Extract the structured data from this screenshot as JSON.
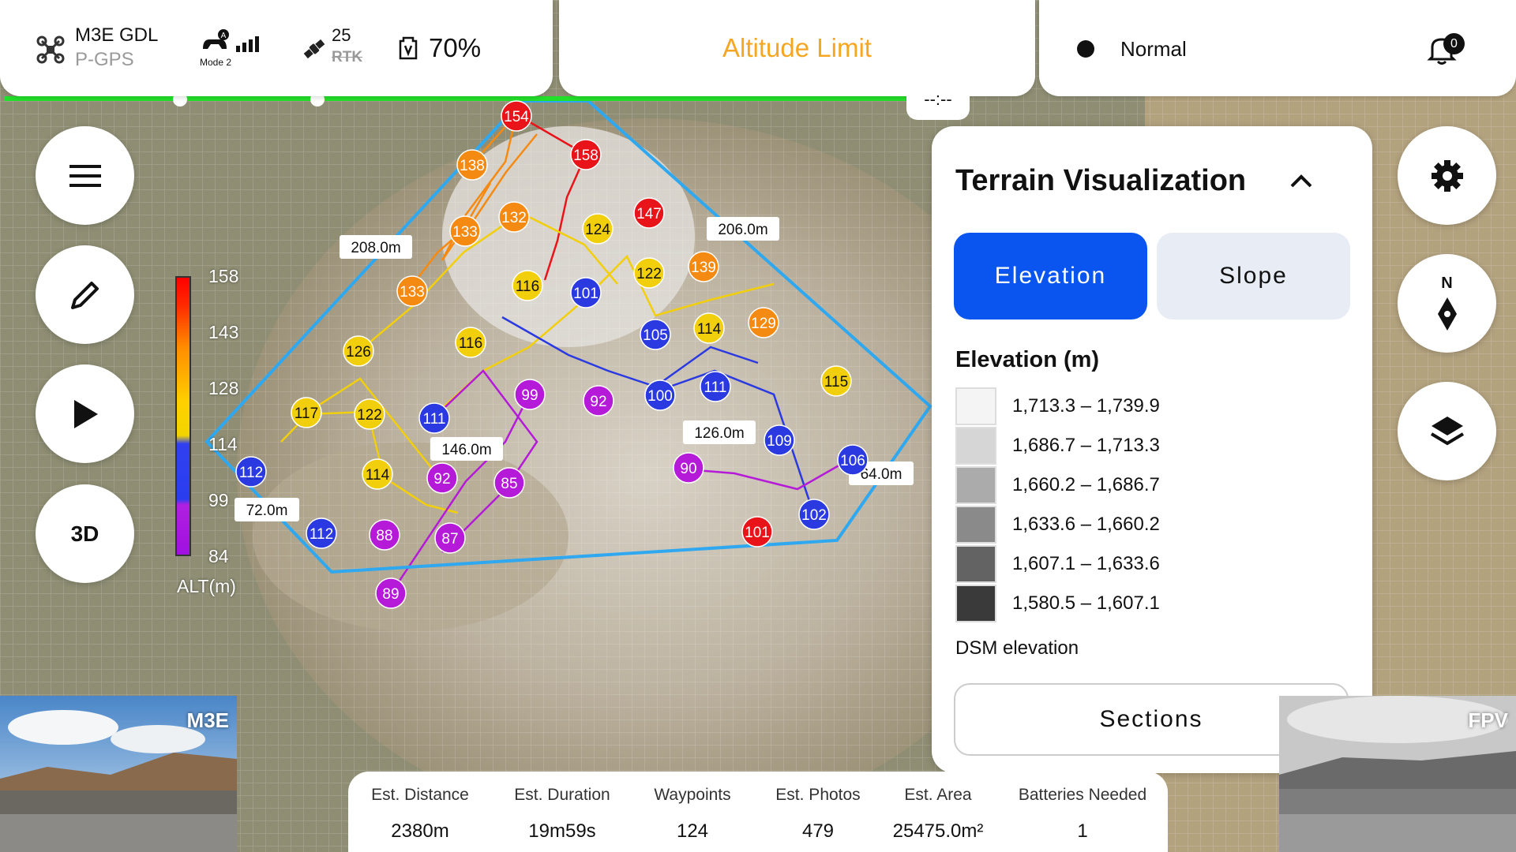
{
  "status": {
    "drone_name": "M3E GDL",
    "gps_mode": "P-GPS",
    "rc_mode": "Mode 2",
    "satellite_count": "25",
    "rtk_label": "RTK",
    "battery_percent": "70%"
  },
  "warning": {
    "text": "Altitude Limit"
  },
  "notice": {
    "status_text": "Normal",
    "notification_count": "0"
  },
  "time_remaining": "--:--",
  "left_buttons": {
    "three_d_label": "3D"
  },
  "altitude_legend": {
    "ticks": [
      "158",
      "143",
      "128",
      "114",
      "99",
      "84"
    ],
    "unit": "ALT(m)"
  },
  "compass": {
    "north_label": "N"
  },
  "terrain_panel": {
    "title": "Terrain Visualization",
    "tabs": [
      {
        "label": "Elevation",
        "active": true
      },
      {
        "label": "Slope",
        "active": false
      }
    ],
    "subtitle": "Elevation (m)",
    "legend": [
      {
        "range": "1,713.3 – 1,739.9",
        "color": "#f4f4f4"
      },
      {
        "range": "1,686.7 – 1,713.3",
        "color": "#d6d6d6"
      },
      {
        "range": "1,660.2 – 1,686.7",
        "color": "#ababab"
      },
      {
        "range": "1,633.6 – 1,660.2",
        "color": "#8a8a8a"
      },
      {
        "range": "1,607.1 – 1,633.6",
        "color": "#636363"
      },
      {
        "range": "1,580.5 – 1,607.1",
        "color": "#3a3a3a"
      }
    ],
    "note": "DSM elevation",
    "sections_label": "Sections"
  },
  "distance_labels": [
    "208.0m",
    "206.0m",
    "146.0m",
    "126.0m",
    "72.0m",
    "64.0m"
  ],
  "waypoints": [
    {
      "label": "154",
      "color": "#e8141a"
    },
    {
      "label": "158",
      "color": "#e8141a"
    },
    {
      "label": "138",
      "color": "#f58a12"
    },
    {
      "label": "147",
      "color": "#e8141a"
    },
    {
      "label": "133",
      "color": "#f58a12"
    },
    {
      "label": "132",
      "color": "#f58a12"
    },
    {
      "label": "124",
      "color": "#f2cf0c"
    },
    {
      "label": "133",
      "color": "#f58a12"
    },
    {
      "label": "116",
      "color": "#f2cf0c"
    },
    {
      "label": "101",
      "color": "#2a3ae0"
    },
    {
      "label": "122",
      "color": "#f2cf0c"
    },
    {
      "label": "139",
      "color": "#f58a12"
    },
    {
      "label": "116",
      "color": "#f2cf0c"
    },
    {
      "label": "105",
      "color": "#2a3ae0"
    },
    {
      "label": "114",
      "color": "#f2cf0c"
    },
    {
      "label": "129",
      "color": "#f58a12"
    },
    {
      "label": "126",
      "color": "#f2cf0c"
    },
    {
      "label": "99",
      "color": "#b41ad8"
    },
    {
      "label": "92",
      "color": "#b41ad8"
    },
    {
      "label": "100",
      "color": "#2a3ae0"
    },
    {
      "label": "111",
      "color": "#2a3ae0"
    },
    {
      "label": "115",
      "color": "#f2cf0c"
    },
    {
      "label": "117",
      "color": "#f2cf0c"
    },
    {
      "label": "122",
      "color": "#f2cf0c"
    },
    {
      "label": "111",
      "color": "#2a3ae0"
    },
    {
      "label": "109",
      "color": "#2a3ae0"
    },
    {
      "label": "112",
      "color": "#2a3ae0"
    },
    {
      "label": "114",
      "color": "#f2cf0c"
    },
    {
      "label": "92",
      "color": "#b41ad8"
    },
    {
      "label": "85",
      "color": "#b41ad8"
    },
    {
      "label": "90",
      "color": "#b41ad8"
    },
    {
      "label": "106",
      "color": "#2a3ae0"
    },
    {
      "label": "112",
      "color": "#2a3ae0"
    },
    {
      "label": "88",
      "color": "#b41ad8"
    },
    {
      "label": "87",
      "color": "#b41ad8"
    },
    {
      "label": "102",
      "color": "#2a3ae0"
    },
    {
      "label": "101",
      "color": "#e8141a"
    },
    {
      "label": "89",
      "color": "#b41ad8"
    }
  ],
  "stats": [
    {
      "label": "Est. Distance",
      "value": "2380m"
    },
    {
      "label": "Est. Duration",
      "value": "19m59s"
    },
    {
      "label": "Waypoints",
      "value": "124"
    },
    {
      "label": "Est. Photos",
      "value": "479"
    },
    {
      "label": "Est. Area",
      "value": "25475.0m²"
    },
    {
      "label": "Batteries Needed",
      "value": "1"
    }
  ],
  "cameras": {
    "main_label": "M3E",
    "fpv_label": "FPV"
  },
  "colors": {
    "accent": "#0a55f0",
    "warning": "#f5a623",
    "route": "#2fa8f0",
    "progress": "#22e02a"
  }
}
